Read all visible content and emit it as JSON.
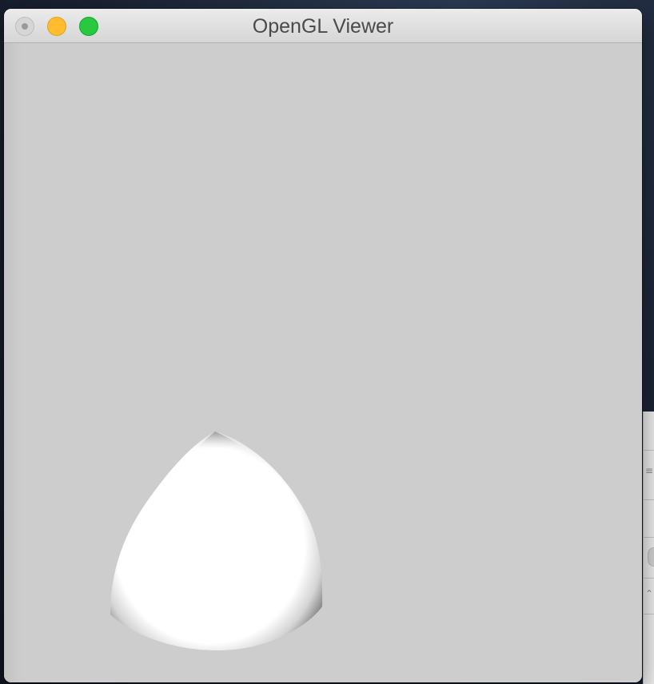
{
  "window": {
    "title": "OpenGL Viewer"
  },
  "traffic_lights": [
    {
      "role": "close",
      "color": "#d6d6d6"
    },
    {
      "role": "minimize",
      "color": "#febc2e"
    },
    {
      "role": "zoom",
      "color": "#28c840"
    }
  ],
  "viewport": {
    "background_color": "#cdcdcd",
    "object": {
      "kind": "shaded-sphere-patch",
      "fill": "#ffffff",
      "shade": "#6e6e6e"
    }
  },
  "background_panel_icons": [
    "list-icon",
    "chevron-icon"
  ]
}
